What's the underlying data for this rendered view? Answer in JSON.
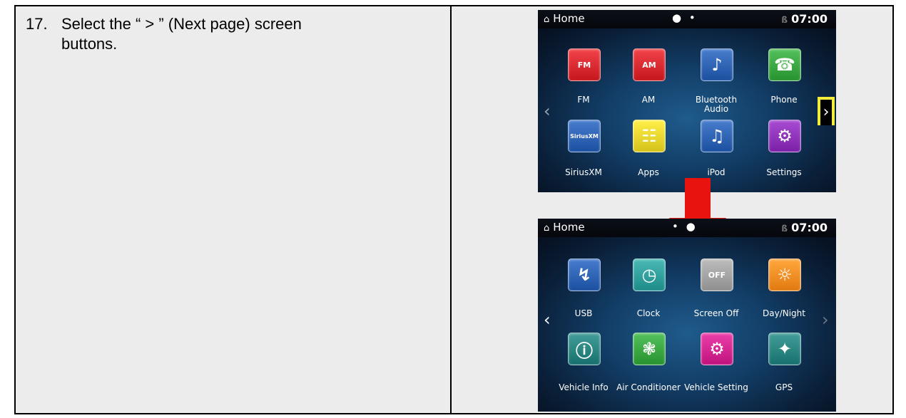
{
  "instruction": {
    "number": "17.",
    "text": "Select the “ > ” (Next page) screen",
    "continuation": "buttons."
  },
  "screen1": {
    "title": "Home",
    "page_indicator": "● •",
    "time": "07:00",
    "apps": [
      {
        "label": "FM",
        "icon": "fm-radio-icon",
        "glyph": "FM",
        "color": "#c4161c"
      },
      {
        "label": "AM",
        "icon": "am-radio-icon",
        "glyph": "AM",
        "color": "#c4161c"
      },
      {
        "label": "Bluetooth Audio",
        "icon": "bluetooth-audio-icon",
        "glyph": "♪",
        "color": "#1b4fa0"
      },
      {
        "label": "Phone",
        "icon": "phone-icon",
        "glyph": "☎",
        "color": "#27932e"
      },
      {
        "label": "SiriusXM",
        "icon": "siriusxm-icon",
        "glyph": "SiriusXM",
        "color": "#1b4fa0"
      },
      {
        "label": "Apps",
        "icon": "apps-grid-icon",
        "glyph": "☷",
        "color": "#d4c21b"
      },
      {
        "label": "iPod",
        "icon": "music-note-icon",
        "glyph": "♫",
        "color": "#1b4fa0"
      },
      {
        "label": "Settings",
        "icon": "settings-gear-icon",
        "glyph": "⚙",
        "color": "#7a1fa6"
      }
    ],
    "prev_glyph": "‹",
    "next_glyph": "›"
  },
  "screen2": {
    "title": "Home",
    "page_indicator": "• ●",
    "time": "07:00",
    "apps": [
      {
        "label": "USB",
        "icon": "usb-icon",
        "glyph": "↯",
        "color": "#1b4fa0"
      },
      {
        "label": "Clock",
        "icon": "clock-icon",
        "glyph": "◷",
        "color": "#1d8c88"
      },
      {
        "label": "Screen Off",
        "icon": "screen-off-icon",
        "glyph": "OFF",
        "color": "#8f8f8f"
      },
      {
        "label": "Day/Night",
        "icon": "day-night-icon",
        "glyph": "☼",
        "color": "#e17a10"
      },
      {
        "label": "Vehicle Info",
        "icon": "vehicle-info-icon",
        "glyph": "ⓘ",
        "color": "#16706c"
      },
      {
        "label": "Air Conditioner",
        "icon": "air-conditioner-fan-icon",
        "glyph": "❃",
        "color": "#27932e"
      },
      {
        "label": "Vehicle Setting",
        "icon": "vehicle-setting-icon",
        "glyph": "⚙",
        "color": "#c0127c"
      },
      {
        "label": "GPS",
        "icon": "gps-satellite-icon",
        "glyph": "✦",
        "color": "#16706c"
      }
    ],
    "prev_glyph": "‹",
    "next_glyph": "›"
  }
}
